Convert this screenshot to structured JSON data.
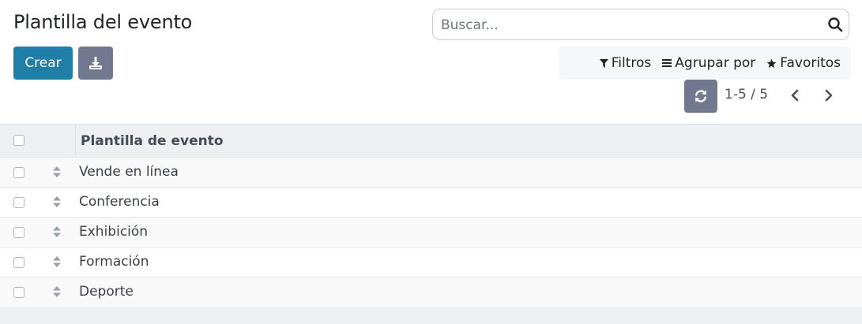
{
  "page": {
    "title": "Plantilla del evento"
  },
  "search": {
    "placeholder": "Buscar..."
  },
  "toolbar": {
    "create_label": "Crear"
  },
  "filters": {
    "filtros": "Filtros",
    "agrupar": "Agrupar por",
    "favoritos": "Favoritos"
  },
  "pager": {
    "text": "1-5 / 5"
  },
  "table": {
    "header": "Plantilla de evento",
    "rows": [
      {
        "name": "Vende en línea"
      },
      {
        "name": "Conferencia"
      },
      {
        "name": "Exhibición"
      },
      {
        "name": "Formación"
      },
      {
        "name": "Deporte"
      }
    ]
  },
  "colors": {
    "primary": "#1f7fa6",
    "secondary": "#71788f"
  }
}
